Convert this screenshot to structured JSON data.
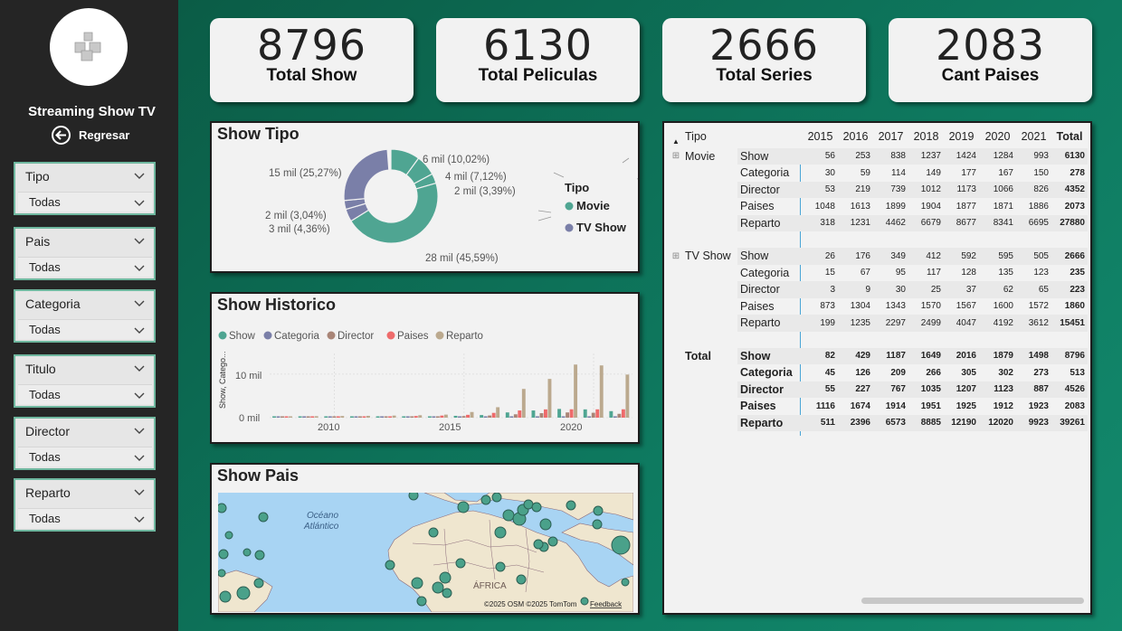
{
  "sidebar": {
    "app_title": "Streaming Show TV",
    "back_label": "Regresar",
    "logo_icon": "cubes-icon",
    "slicers": [
      {
        "label": "Tipo",
        "value": "Todas"
      },
      {
        "label": "Pais",
        "value": "Todas"
      },
      {
        "label": "Categoria",
        "value": "Todas"
      },
      {
        "label": "Titulo",
        "value": "Todas"
      },
      {
        "label": "Director",
        "value": "Todas"
      },
      {
        "label": "Reparto",
        "value": "Todas"
      }
    ]
  },
  "kpis": [
    {
      "value": "8796",
      "label": "Total Show"
    },
    {
      "value": "6130",
      "label": "Total Peliculas"
    },
    {
      "value": "2666",
      "label": "Total Series"
    },
    {
      "value": "2083",
      "label": "Cant Paises"
    }
  ],
  "show_tipo": {
    "title": "Show Tipo",
    "legend_title": "Tipo",
    "legend": [
      {
        "name": "Movie",
        "color": "#4fa592"
      },
      {
        "name": "TV Show",
        "color": "#7a7fa8"
      }
    ],
    "labels": [
      "6 mil (10,02%)",
      "4 mil (7,12%)",
      "2 mil (3,39%)",
      "28 mil (45,59%)",
      "3 mil (4,36%)",
      "2 mil (3,04%)",
      "15 mil (25,27%)"
    ]
  },
  "show_historico": {
    "title": "Show Historico",
    "y_axis_label": "Show, Catego...",
    "y_ticks": [
      "10 mil",
      "0 mil"
    ],
    "x_ticks": [
      "2010",
      "2015",
      "2020"
    ]
  },
  "show_pais": {
    "title": "Show Pais",
    "ocean_label_1": "Océano",
    "ocean_label_2": "Atlántico",
    "continent_label": "ÁFRICA",
    "attribution": "©2025 OSM  ©2025 TomTom",
    "feedback_label": "Feedback"
  },
  "matrix": {
    "header": {
      "tipo": "Tipo",
      "years": [
        "2015",
        "2016",
        "2017",
        "2018",
        "2019",
        "2020",
        "2021"
      ],
      "total": "Total"
    },
    "groups": [
      {
        "name": "Movie",
        "rows": [
          {
            "label": "Show",
            "values": [
              "56",
              "253",
              "838",
              "1237",
              "1424",
              "1284",
              "993",
              "6130"
            ]
          },
          {
            "label": "Categoria",
            "values": [
              "30",
              "59",
              "114",
              "149",
              "177",
              "167",
              "150",
              "278"
            ]
          },
          {
            "label": "Director",
            "values": [
              "53",
              "219",
              "739",
              "1012",
              "1173",
              "1066",
              "826",
              "4352"
            ]
          },
          {
            "label": "Paises",
            "values": [
              "1048",
              "1613",
              "1899",
              "1904",
              "1877",
              "1871",
              "1886",
              "2073"
            ]
          },
          {
            "label": "Reparto",
            "values": [
              "318",
              "1231",
              "4462",
              "6679",
              "8677",
              "8341",
              "6695",
              "27880"
            ]
          }
        ]
      },
      {
        "name": "TV Show",
        "rows": [
          {
            "label": "Show",
            "values": [
              "26",
              "176",
              "349",
              "412",
              "592",
              "595",
              "505",
              "2666"
            ]
          },
          {
            "label": "Categoria",
            "values": [
              "15",
              "67",
              "95",
              "117",
              "128",
              "135",
              "123",
              "235"
            ]
          },
          {
            "label": "Director",
            "values": [
              "3",
              "9",
              "30",
              "25",
              "37",
              "62",
              "65",
              "223"
            ]
          },
          {
            "label": "Paises",
            "values": [
              "873",
              "1304",
              "1343",
              "1570",
              "1567",
              "1600",
              "1572",
              "1860"
            ]
          },
          {
            "label": "Reparto",
            "values": [
              "199",
              "1235",
              "2297",
              "2499",
              "4047",
              "4192",
              "3612",
              "15451"
            ]
          }
        ]
      }
    ],
    "total": {
      "name": "Total",
      "rows": [
        {
          "label": "Show",
          "values": [
            "82",
            "429",
            "1187",
            "1649",
            "2016",
            "1879",
            "1498",
            "8796"
          ]
        },
        {
          "label": "Categoria",
          "values": [
            "45",
            "126",
            "209",
            "266",
            "305",
            "302",
            "273",
            "513"
          ]
        },
        {
          "label": "Director",
          "values": [
            "55",
            "227",
            "767",
            "1035",
            "1207",
            "1123",
            "887",
            "4526"
          ]
        },
        {
          "label": "Paises",
          "values": [
            "1116",
            "1674",
            "1914",
            "1951",
            "1925",
            "1912",
            "1923",
            "2083"
          ]
        },
        {
          "label": "Reparto",
          "values": [
            "511",
            "2396",
            "6573",
            "8885",
            "12190",
            "12020",
            "9923",
            "39261"
          ]
        }
      ]
    }
  },
  "chart_data": [
    {
      "type": "pie",
      "title": "Show Tipo",
      "legend_title": "Tipo",
      "series_names": [
        "Movie",
        "TV Show"
      ],
      "slices": [
        {
          "series": "Movie",
          "label": "6 mil (10,02%)",
          "percent": 10.02
        },
        {
          "series": "Movie",
          "label": "4 mil (7,12%)",
          "percent": 7.12
        },
        {
          "series": "Movie",
          "label": "2 mil (3,39%)",
          "percent": 3.39
        },
        {
          "series": "Movie",
          "label": "28 mil (45,59%)",
          "percent": 45.59
        },
        {
          "series": "TV Show",
          "label": "3 mil (4,36%)",
          "percent": 4.36
        },
        {
          "series": "TV Show",
          "label": "2 mil (3,04%)",
          "percent": 3.04
        },
        {
          "series": "TV Show",
          "label": "15 mil (25,27%)",
          "percent": 25.27
        }
      ],
      "colors": {
        "Movie": "#4fa592",
        "TV Show": "#7a7fa8"
      }
    },
    {
      "type": "bar",
      "title": "Show Historico",
      "ylabel": "Show, Catego...",
      "x": [
        2008,
        2009,
        2010,
        2011,
        2012,
        2013,
        2014,
        2015,
        2016,
        2017,
        2018,
        2019,
        2020,
        2021
      ],
      "ylim": [
        0,
        13500
      ],
      "series": [
        {
          "name": "Show",
          "color": "#4fa592",
          "values": [
            130,
            150,
            160,
            180,
            200,
            240,
            300,
            420,
            600,
            1200,
            1650,
            2000,
            1900,
            1500
          ]
        },
        {
          "name": "Categoria",
          "color": "#7a7fa8",
          "values": [
            40,
            45,
            50,
            55,
            60,
            70,
            90,
            110,
            150,
            210,
            270,
            300,
            300,
            270
          ]
        },
        {
          "name": "Director",
          "color": "#a98577",
          "values": [
            110,
            130,
            140,
            160,
            180,
            210,
            260,
            360,
            500,
            770,
            1030,
            1200,
            1120,
            880
          ]
        },
        {
          "name": "Paises",
          "color": "#ee6b6b",
          "values": [
            180,
            210,
            230,
            270,
            300,
            380,
            480,
            650,
            1100,
            1650,
            1900,
            1920,
            1910,
            1920
          ]
        },
        {
          "name": "Reparto",
          "color": "#bba98e",
          "values": [
            300,
            340,
            380,
            420,
            480,
            560,
            700,
            1300,
            2400,
            6600,
            8900,
            12200,
            12000,
            9900
          ]
        }
      ]
    }
  ]
}
